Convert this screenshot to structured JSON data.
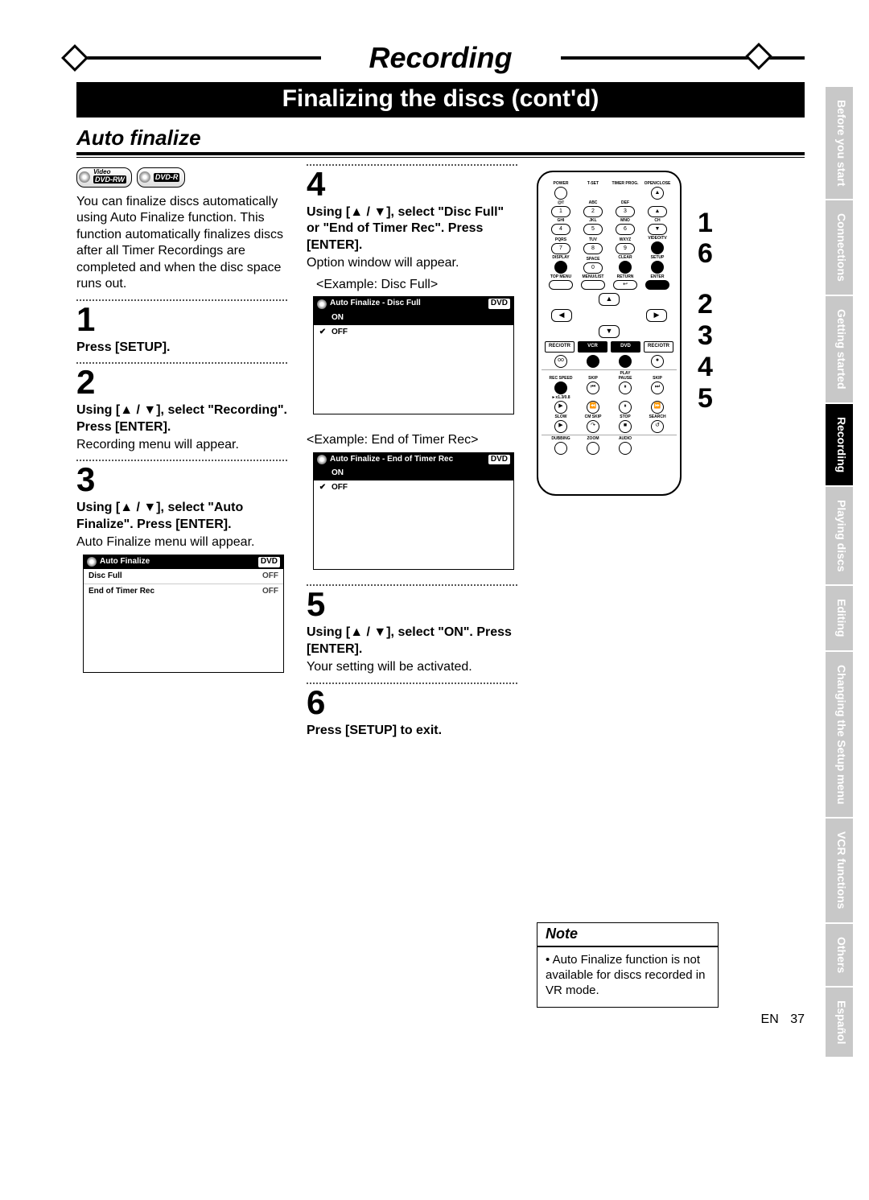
{
  "banner": {
    "category": "Recording",
    "subtitle": "Finalizing the discs (cont'd)",
    "section": "Auto finalize"
  },
  "badges": {
    "videorw_top": "Video",
    "videorw": "DVD-RW",
    "dvdr": "DVD-R"
  },
  "intro": "You can finalize discs automatically using Auto Finalize function. This function automatically finalizes discs after all Timer Recordings are completed and when the disc space runs out.",
  "steps": {
    "s1": {
      "num": "1",
      "bold": "Press [SETUP]."
    },
    "s2": {
      "num": "2",
      "bold": "Using [▲ / ▼], select \"Recording\". Press [ENTER].",
      "text": "Recording menu will appear."
    },
    "s3": {
      "num": "3",
      "bold": "Using [▲ / ▼], select \"Auto Finalize\". Press [ENTER].",
      "text": "Auto Finalize menu will appear."
    },
    "s4": {
      "num": "4",
      "bold": "Using [▲ / ▼], select \"Disc Full\" or \"End of Timer Rec\". Press [ENTER].",
      "text": "Option window will appear.",
      "caption1": "<Example: Disc Full>",
      "caption2": "<Example: End of Timer Rec>"
    },
    "s5": {
      "num": "5",
      "bold": "Using [▲ / ▼], select \"ON\". Press [ENTER].",
      "text": "Your setting will be activated."
    },
    "s6": {
      "num": "6",
      "bold": "Press [SETUP] to exit."
    }
  },
  "osd_menu": {
    "title": "Auto Finalize",
    "badge": "DVD",
    "rows": [
      {
        "k": "Disc Full",
        "v": "OFF"
      },
      {
        "k": "End of Timer Rec",
        "v": "OFF"
      }
    ]
  },
  "osd_discfull": {
    "title": "Auto Finalize - Disc Full",
    "badge": "DVD",
    "options": [
      {
        "label": "ON",
        "selected": true,
        "checked": false
      },
      {
        "label": "OFF",
        "selected": false,
        "checked": true
      }
    ]
  },
  "osd_endtimer": {
    "title": "Auto Finalize - End of Timer Rec",
    "badge": "DVD",
    "options": [
      {
        "label": "ON",
        "selected": true,
        "checked": false
      },
      {
        "label": "OFF",
        "selected": false,
        "checked": true
      }
    ]
  },
  "callouts": [
    "1",
    "6",
    "2",
    "3",
    "4",
    "5"
  ],
  "remote_labels": {
    "power": "POWER",
    "openclose": "OPEN/CLOSE",
    "tset": "T-SET",
    "timerprog": "TIMER PROG.",
    "abc": "ABC",
    "def": "DEF",
    "ghi": "GHI",
    "jkl": "JKL",
    "mno": "MNO",
    "ch": "CH",
    "pqrs": "PQRS",
    "tuv": "TUV",
    "wxyz": "WXYZ",
    "videotv": "VIDEO/TV",
    "display": "DISPLAY",
    "space": "SPACE",
    "clear": "CLEAR",
    "setup": "SETUP",
    "topmenu": "TOP MENU",
    "menulist": "MENU/LIST",
    "return": "RETURN",
    "enter": "ENTER",
    "recotr": "REC/OTR",
    "vcr": "VCR",
    "dvd": "DVD",
    "recspeed": "REC SPEED",
    "play": "PLAY",
    "skip": "SKIP",
    "pause": "PAUSE",
    "x12": "►x1.3/0.8",
    "slow": "SLOW",
    "cmskip": "CM SKIP",
    "stop": "STOP",
    "search": "SEARCH",
    "dubbing": "DUBBING",
    "zoom": "ZOOM",
    "audio": "AUDIO",
    "n1": "1",
    "n2": "2",
    "n3": "3",
    "n4": "4",
    "n5": "5",
    "n6": "6",
    "n7": "7",
    "n8": "8",
    "n9": "9",
    "n0": "0",
    "at": "@/!"
  },
  "note": {
    "title": "Note",
    "text": "• Auto Finalize function is not available for discs recorded in VR mode."
  },
  "side_tabs": [
    "Before you start",
    "Connections",
    "Getting started",
    "Recording",
    "Playing discs",
    "Editing",
    "Changing the Setup menu",
    "VCR functions",
    "Others",
    "Español"
  ],
  "active_tab_index": 3,
  "footer": {
    "lang": "EN",
    "page": "37"
  }
}
